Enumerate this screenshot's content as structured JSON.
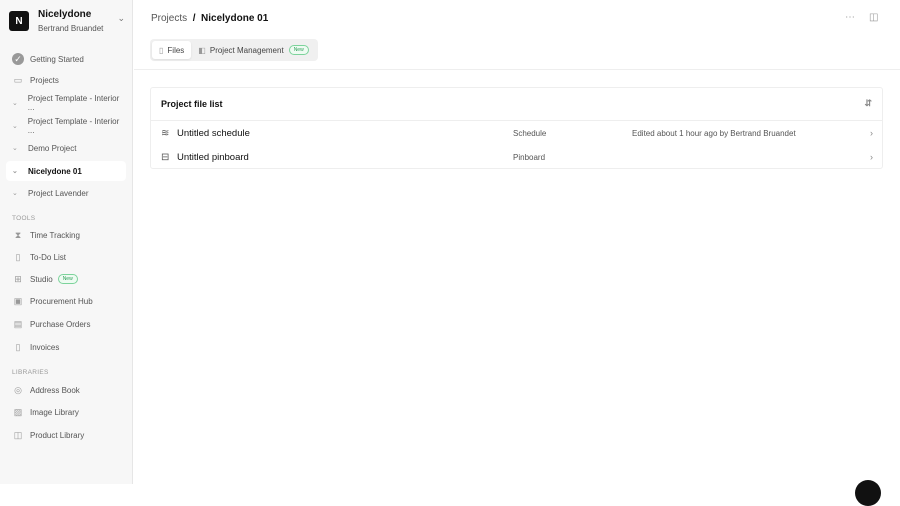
{
  "workspace": {
    "initial": "N",
    "name": "Nicelydone",
    "user": "Bertrand Bruandet"
  },
  "sidebar": {
    "getting_started": "Getting Started",
    "projects": "Projects",
    "project_items": [
      "Project Template - Interior ...",
      "Project Template - Interior ...",
      "Demo Project",
      "Nicelydone 01",
      "Project Lavender"
    ],
    "tools_label": "TOOLS",
    "tools": [
      "Time Tracking",
      "To-Do List",
      "Studio",
      "Procurement Hub",
      "Purchase Orders",
      "Invoices"
    ],
    "studio_badge": "New",
    "libraries_label": "LIBRARIES",
    "libraries": [
      "Address Book",
      "Image Library",
      "Product Library"
    ]
  },
  "breadcrumb": {
    "parent": "Projects",
    "sep": "/",
    "current": "Nicelydone 01"
  },
  "tabs": {
    "files": "Files",
    "pm": "Project Management",
    "pm_badge": "New"
  },
  "filelist": {
    "title": "Project file list",
    "rows": [
      {
        "name": "Untitled schedule",
        "type": "Schedule",
        "edited": "Edited about 1 hour ago by Bertrand Bruandet"
      },
      {
        "name": "Untitled pinboard",
        "type": "Pinboard",
        "edited": ""
      }
    ]
  }
}
